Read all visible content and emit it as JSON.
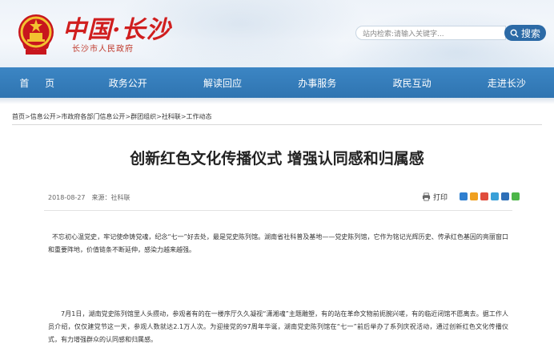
{
  "site": {
    "title": "中国·长沙",
    "subtitle": "长沙市人民政府"
  },
  "search": {
    "placeholder": "站内检索:请输入关键字...",
    "button_label": "搜索"
  },
  "nav": {
    "items": [
      "首 页",
      "政务公开",
      "解读回应",
      "办事服务",
      "政民互动",
      "走进长沙"
    ]
  },
  "breadcrumb": [
    "首页",
    "信息公开",
    "市政府各部门信息公开",
    "群团组织",
    "社科联",
    "工作动态"
  ],
  "breadcrumb_separator": ">",
  "article": {
    "title": "创新红色文化传播仪式 增强认同感和归属感",
    "date": "2018-08-27",
    "source": "来源：社科联",
    "print_label": "打印",
    "paragraph1": "不忘初心温党史，牢记使命铸党魂，纪念“七一”好去处，最是党史陈列馆。湖南省社科普及基地——党史陈列馆，它作为铭记光辉历史、传承红色基因的亮丽窗口和重要阵地，价值链条不断延伸，感染力越来越强。",
    "paragraph2": "7月1日，湖南党史陈列馆里人头攒动，参观者有的在一楼序厅久久凝视“潇湘魂”主题雕塑，有的站在革命文物前扼腕兴嗟，有的临近闭馆不愿离去。据工作人员介绍，仅仅建党节这一天，参观人数就达2.1万人次。为迎接党的97周年华诞，湖南党史陈列馆在“七一”前后举办了系列庆祝活动，通过创新红色文化传播仪式，有力增强群众的认同感和归属感。"
  },
  "colors": {
    "nav_bg": "#3379b8",
    "search_button": "#2c6aa6",
    "logo_red": "#d01e1e"
  },
  "icons": {
    "emblem": "national-emblem-icon",
    "search": "search-icon",
    "print": "printer-icon",
    "share": [
      "share-plus-icon",
      "share-qzone-icon",
      "share-weibo-icon",
      "share-tencent-icon",
      "share-renren-icon",
      "share-wechat-icon"
    ]
  }
}
